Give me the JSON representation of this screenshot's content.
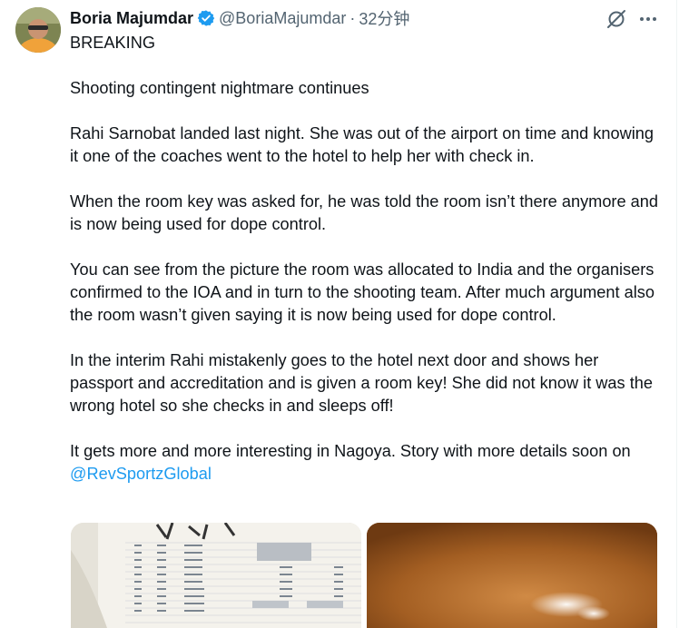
{
  "author": {
    "name": "Boria Majumdar",
    "handle": "@BoriaMajumdar",
    "separator": "·",
    "time": "32分钟"
  },
  "icons": {
    "verified": "verified-badge-icon",
    "grok": "grok-icon",
    "more": "more-options-icon"
  },
  "colors": {
    "accent": "#1d9bf0",
    "text": "#0f1419",
    "secondary": "#536471"
  },
  "tweet": {
    "line1": "BREAKING",
    "line2": "Shooting contingent nightmare continues",
    "para1": "Rahi Sarnobat landed last night. She was out of the airport on time and knowing it one of the coaches went to the hotel to help her with check in.",
    "para2": "When the room key was asked for, he was told the room isn’t there anymore and is now being used for dope control.",
    "para3": "You can see from the picture the room was allocated to India and the organisers confirmed to the IOA and in turn to the shooting team. After much argument also the room wasn’t given saying it is now being used for dope control.",
    "para4": "In the interim Rahi mistakenly goes to the hotel next door and shows her passport and accreditation and is given a room key! She did not know it was the wrong hotel so she checks in and sleeps off!",
    "para5_text": "It gets more and more interesting in Nagoya. Story with more details soon on ",
    "para5_mention": "@RevSportzGlobal"
  },
  "media": {
    "photo1": "room-list-photo",
    "photo2": "wooden-table-photo"
  }
}
